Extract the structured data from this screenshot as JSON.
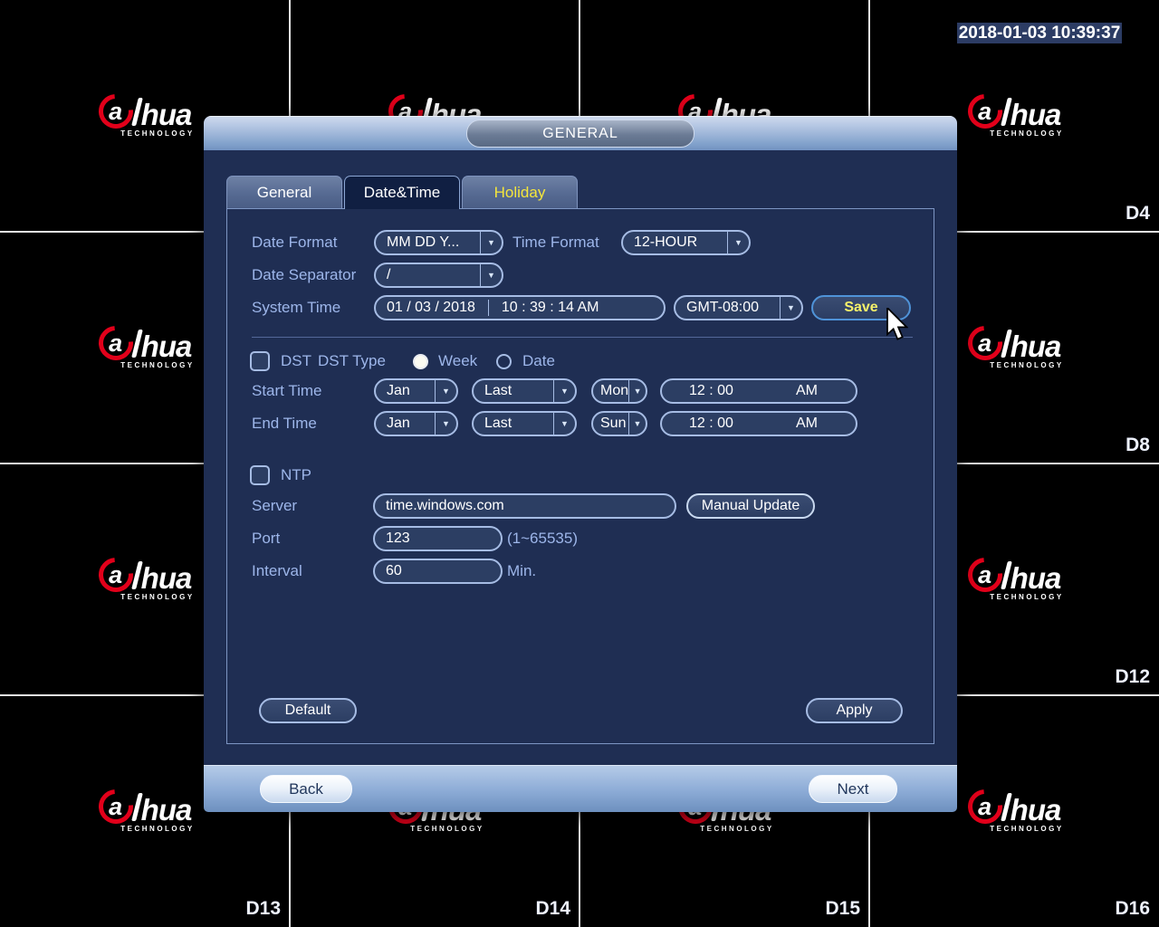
{
  "colors": {
    "brand_red": "#e2001a",
    "holiday_tab_text": "#f5e63c",
    "save_text_yellow": "#f5f16a",
    "field_border": "#a6bce4",
    "dialog_bg": "#1f2e53",
    "label_blue": "#9db6ea"
  },
  "wall": {
    "timestamp": "2018-01-03 10:39:37",
    "brand": {
      "first": "a",
      "rest": "hua",
      "sub": "TECHNOLOGY"
    },
    "cells": [
      {
        "label": ""
      },
      {
        "label": ""
      },
      {
        "label": ""
      },
      {
        "label": "D4"
      },
      {
        "label": ""
      },
      {
        "label": ""
      },
      {
        "label": ""
      },
      {
        "label": "D8"
      },
      {
        "label": ""
      },
      {
        "label": ""
      },
      {
        "label": ""
      },
      {
        "label": "D12"
      },
      {
        "label": "D13"
      },
      {
        "label": "D14"
      },
      {
        "label": "D15"
      },
      {
        "label": "D16"
      }
    ]
  },
  "dialog": {
    "title": "GENERAL",
    "tabs": {
      "general": "General",
      "datetime": "Date&Time",
      "holiday": "Holiday"
    },
    "date_format_label": "Date Format",
    "date_format_value": "MM DD Y...",
    "time_format_label": "Time Format",
    "time_format_value": "12-HOUR",
    "date_separator_label": "Date Separator",
    "date_separator_value": "/",
    "system_time_label": "System Time",
    "system_date_value": "01 / 03 /  2018",
    "system_clock_value": "10  :  39  :  14  AM",
    "timezone_value": "GMT-08:00",
    "save_label": "Save",
    "dst_label": "DST",
    "dst_type_label": "DST Type",
    "week_label": "Week",
    "date_label": "Date",
    "start_time_label": "Start Time",
    "start_month": "Jan",
    "start_week": "Last",
    "start_day": "Mon",
    "start_clock": "12  :  00",
    "start_ampm": "AM",
    "end_time_label": "End Time",
    "end_month": "Jan",
    "end_week": "Last",
    "end_day": "Sun",
    "end_clock": "12  :  00",
    "end_ampm": "AM",
    "ntp_label": "NTP",
    "server_label": "Server",
    "server_value": "time.windows.com",
    "manual_update_label": "Manual Update",
    "port_label": "Port",
    "port_value": "123",
    "port_hint": "(1~65535)",
    "interval_label": "Interval",
    "interval_value": "60",
    "interval_unit": "Min.",
    "default_label": "Default",
    "apply_label": "Apply",
    "back_label": "Back",
    "next_label": "Next"
  }
}
